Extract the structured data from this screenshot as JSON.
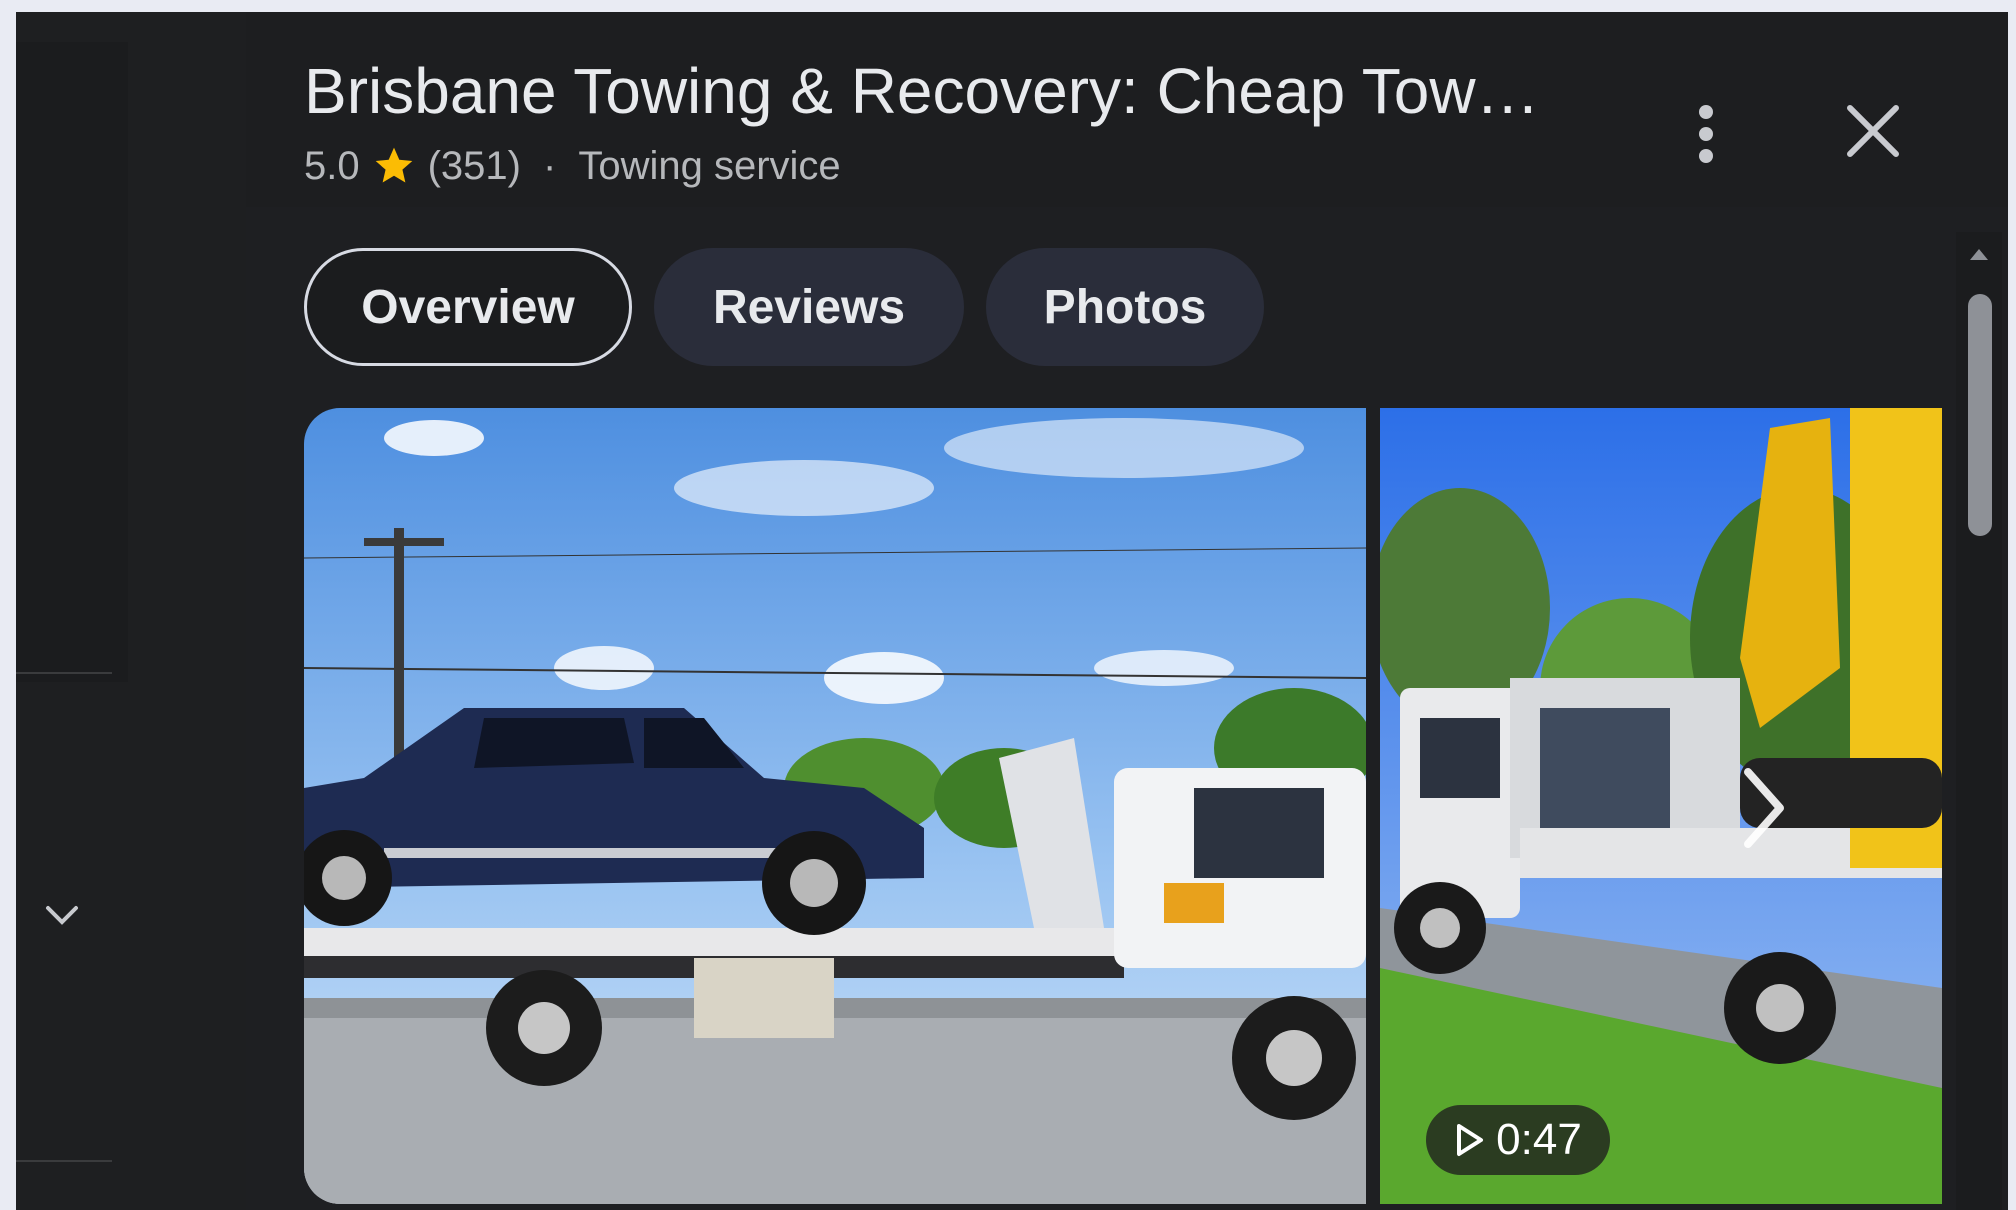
{
  "place": {
    "title": "Brisbane Towing & Recovery: Cheap Tow…",
    "rating": "5.0",
    "reviews_count": "(351)",
    "separator": "·",
    "category": "Towing service"
  },
  "tabs": [
    {
      "label": "Overview",
      "active": true
    },
    {
      "label": "Reviews",
      "active": false
    },
    {
      "label": "Photos",
      "active": false
    }
  ],
  "media": {
    "video_duration": "0:47"
  },
  "icons": {
    "rating_star": "star-icon",
    "more": "more-vert-icon",
    "close": "close-icon",
    "next": "chevron-right-icon",
    "collapse": "chevron-down-icon",
    "play": "play-icon"
  },
  "colors": {
    "background": "#1f1f1f",
    "text": "#e8eaed",
    "secondary_text": "#b6b8bb",
    "star": "#fbbc04",
    "tab_bg": "#2a2d3a"
  }
}
